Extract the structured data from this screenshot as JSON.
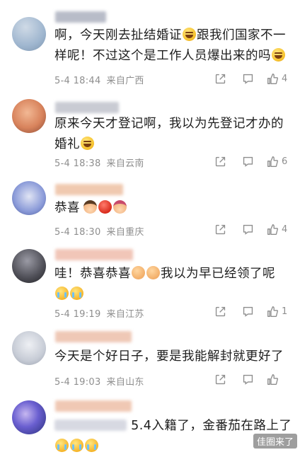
{
  "comments": [
    {
      "text_parts": [
        "啊，今天刚去扯结婚证",
        "跟我们国家不一样呢！不过这个是工作人员爆出来的吗"
      ],
      "emojis": [
        "laugh",
        "laugh"
      ],
      "time": "5-4 18:44",
      "location": "来自广西",
      "likes": "4",
      "avatar_color": "#9fb6cf",
      "name_color": "#b8bcc8"
    },
    {
      "text_parts": [
        "原来今天才登记啊，我以为先登记才办的婚礼"
      ],
      "emojis": [
        "laugh"
      ],
      "time": "5-4 18:38",
      "location": "来自云南",
      "likes": "6",
      "avatar_color": "#d8835c",
      "name_color": "#c9cbd3"
    },
    {
      "text_parts": [
        "恭喜"
      ],
      "emojis": [
        "boy",
        "tomato",
        "girl"
      ],
      "time": "5-4 18:30",
      "location": "来自重庆",
      "likes": "4",
      "avatar_color": "#8a9ad8",
      "name_color": "#f0c9b0"
    },
    {
      "text_parts": [
        "哇！恭喜恭喜",
        "我以为早已经领了呢"
      ],
      "emojis": [
        "face",
        "face",
        "cry",
        "cry"
      ],
      "time": "5-4 19:19",
      "location": "来自江苏",
      "likes": "1",
      "avatar_color": "#4d4d55",
      "name_color": "#f1c6b8"
    },
    {
      "text_parts": [
        "今天是个好日子，要是我能解封就更好了"
      ],
      "emojis": [],
      "time": "5-4 19:03",
      "location": "来自山东",
      "likes": "",
      "avatar_color": "#c7ccd6",
      "name_color": "#efc8b6"
    },
    {
      "text_parts": [
        "5.4入籍了，金番茄在路上了"
      ],
      "emojis": [
        "cry",
        "cry",
        "cry"
      ],
      "time": "",
      "location": "",
      "likes": "",
      "avatar_color": "#3a3fa0",
      "name_color": "#f0c8b4"
    }
  ],
  "icons": {
    "share": "share-icon",
    "comment": "comment-icon",
    "like": "thumbs-up-icon"
  },
  "watermark": "佳圈来了",
  "colors": {
    "meta_gray": "#8e8e8e",
    "text": "#1d1d1d"
  }
}
